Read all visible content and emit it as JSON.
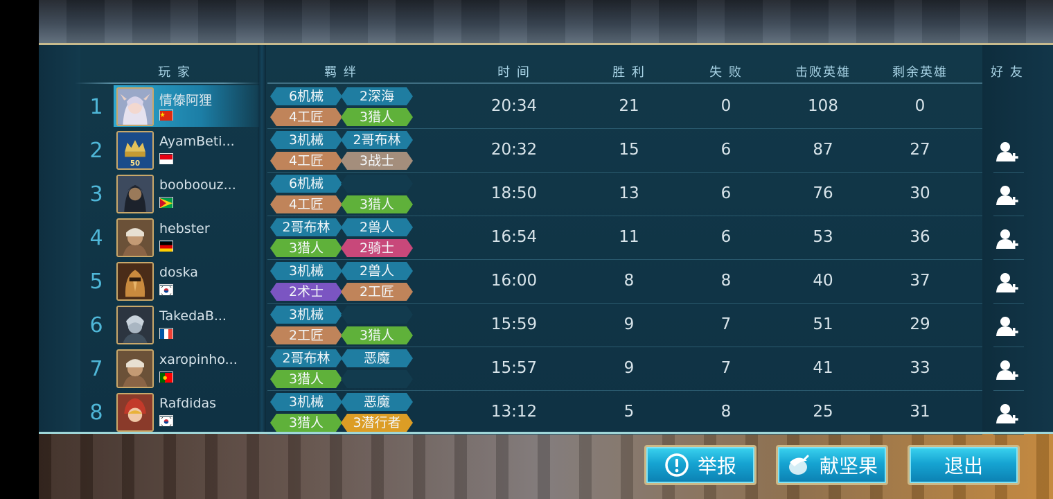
{
  "headers": {
    "player": "玩 家",
    "synergy": "羁 绊",
    "time": "时 间",
    "wins": "胜 利",
    "losses": "失 败",
    "kills": "击败英雄",
    "remaining": "剩余英雄",
    "friends": "好 友"
  },
  "rows": [
    {
      "rank": "1",
      "name": "情傣阿狸",
      "flag": "cn",
      "time": "20:34",
      "wins": "21",
      "losses": "0",
      "kills": "108",
      "remaining": "0",
      "tags": [
        {
          "label": "6机械",
          "color": "#1f7da1"
        },
        {
          "label": "2深海",
          "color": "#1f7da1"
        },
        {
          "label": "4工匠",
          "color": "#c0845a"
        },
        {
          "label": "3猎人",
          "color": "#5fb13a"
        }
      ],
      "friend": false,
      "highlight": true
    },
    {
      "rank": "2",
      "name": "AyamBeti...",
      "flag": "id",
      "time": "20:32",
      "wins": "15",
      "losses": "6",
      "kills": "87",
      "remaining": "27",
      "tags": [
        {
          "label": "3机械",
          "color": "#1f7da1"
        },
        {
          "label": "2哥布林",
          "color": "#1f7da1"
        },
        {
          "label": "4工匠",
          "color": "#c0845a"
        },
        {
          "label": "3战士",
          "color": "#a48e7c"
        }
      ],
      "friend": true
    },
    {
      "rank": "3",
      "name": "booboouz...",
      "flag": "gy",
      "time": "18:50",
      "wins": "13",
      "losses": "6",
      "kills": "76",
      "remaining": "30",
      "tags": [
        {
          "label": "6机械",
          "color": "#1f7da1"
        },
        {
          "label": "",
          "color": ""
        },
        {
          "label": "4工匠",
          "color": "#c0845a"
        },
        {
          "label": "3猎人",
          "color": "#5fb13a"
        }
      ],
      "friend": true
    },
    {
      "rank": "4",
      "name": "hebster",
      "flag": "de",
      "time": "16:54",
      "wins": "11",
      "losses": "6",
      "kills": "53",
      "remaining": "36",
      "tags": [
        {
          "label": "2哥布林",
          "color": "#1f7da1"
        },
        {
          "label": "2兽人",
          "color": "#1f7da1"
        },
        {
          "label": "3猎人",
          "color": "#5fb13a"
        },
        {
          "label": "2骑士",
          "color": "#c8487a"
        }
      ],
      "friend": true
    },
    {
      "rank": "5",
      "name": "doska",
      "flag": "kr",
      "time": "16:00",
      "wins": "8",
      "losses": "8",
      "kills": "40",
      "remaining": "37",
      "tags": [
        {
          "label": "3机械",
          "color": "#1f7da1"
        },
        {
          "label": "2兽人",
          "color": "#1f7da1"
        },
        {
          "label": "2术士",
          "color": "#7b55c2"
        },
        {
          "label": "2工匠",
          "color": "#c0845a"
        }
      ],
      "friend": true
    },
    {
      "rank": "6",
      "name": "TakedaB...",
      "flag": "fr",
      "time": "15:59",
      "wins": "9",
      "losses": "7",
      "kills": "51",
      "remaining": "29",
      "tags": [
        {
          "label": "3机械",
          "color": "#1f7da1"
        },
        {
          "label": "",
          "color": ""
        },
        {
          "label": "2工匠",
          "color": "#c0845a"
        },
        {
          "label": "3猎人",
          "color": "#5fb13a"
        }
      ],
      "friend": true
    },
    {
      "rank": "7",
      "name": "xaropinho...",
      "flag": "pt",
      "time": "15:57",
      "wins": "9",
      "losses": "7",
      "kills": "41",
      "remaining": "33",
      "tags": [
        {
          "label": "2哥布林",
          "color": "#1f7da1"
        },
        {
          "label": "恶魔",
          "color": "#1f7da1"
        },
        {
          "label": "3猎人",
          "color": "#5fb13a"
        },
        {
          "label": "",
          "color": ""
        }
      ],
      "friend": true
    },
    {
      "rank": "8",
      "name": "Rafdidas",
      "flag": "kr",
      "time": "13:12",
      "wins": "5",
      "losses": "8",
      "kills": "25",
      "remaining": "31",
      "tags": [
        {
          "label": "3机械",
          "color": "#1f7da1"
        },
        {
          "label": "恶魔",
          "color": "#1f7da1"
        },
        {
          "label": "3猎人",
          "color": "#5fb13a"
        },
        {
          "label": "3潜行者",
          "color": "#dc9d25"
        }
      ],
      "friend": true
    }
  ],
  "rank2_badge": "50",
  "buttons": {
    "report": "举报",
    "nuts": "献坚果",
    "exit": "退出"
  },
  "icons": {
    "friend": "add-friend-icon",
    "report": "exclamation-icon",
    "nuts": "acorn-icon"
  }
}
